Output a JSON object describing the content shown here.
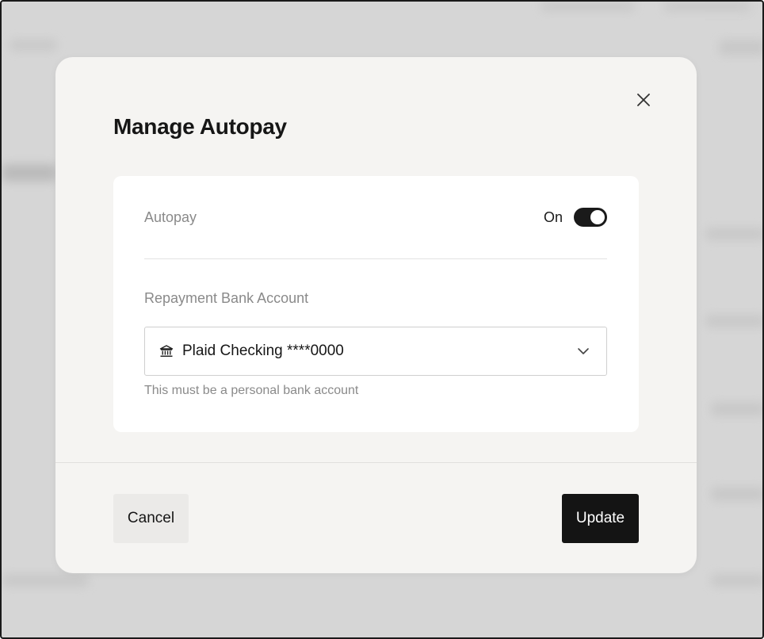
{
  "modal": {
    "title": "Manage Autopay",
    "close_label": "Close"
  },
  "autopay": {
    "label": "Autopay",
    "state_text": "On",
    "enabled": true
  },
  "repayment": {
    "label": "Repayment Bank Account",
    "selected_value": "Plaid Checking ****0000",
    "helper_text": "This must be a personal bank account",
    "icon": "bank-icon"
  },
  "footer": {
    "cancel_label": "Cancel",
    "update_label": "Update"
  },
  "colors": {
    "primary_button": "#141414",
    "toggle_on": "#1a1a1a",
    "modal_bg": "#f5f4f2",
    "overlay": "#d6d6d6"
  }
}
